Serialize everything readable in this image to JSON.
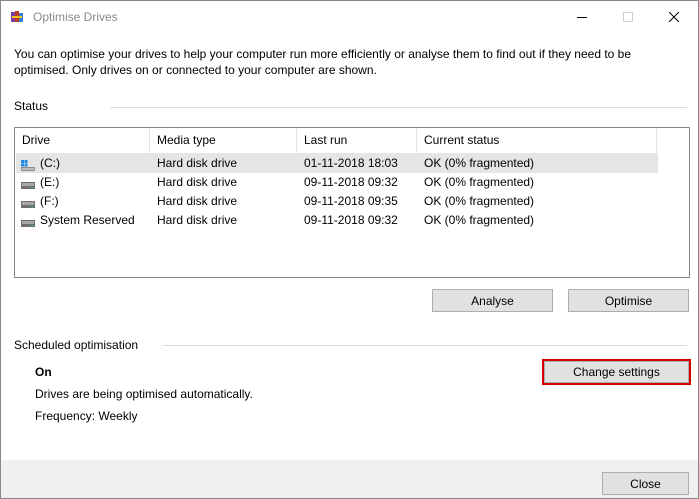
{
  "window": {
    "title": "Optimise Drives",
    "app_icon": "defrag-app-icon",
    "controls": {
      "minimize": "minimize-icon",
      "maximize": "maximize-icon",
      "close": "close-icon"
    }
  },
  "description": "You can optimise your drives to help your computer run more efficiently or analyse them to find out if they need to be optimised. Only drives on or connected to your computer are shown.",
  "status": {
    "label": "Status",
    "columns": [
      "Drive",
      "Media type",
      "Last run",
      "Current status"
    ],
    "rows": [
      {
        "icon": "system-drive-icon",
        "drive": "(C:)",
        "media": "Hard disk drive",
        "last_run": "01-11-2018 18:03",
        "status": "OK (0% fragmented)"
      },
      {
        "icon": "hard-drive-icon",
        "drive": "(E:)",
        "media": "Hard disk drive",
        "last_run": "09-11-2018 09:32",
        "status": "OK (0% fragmented)"
      },
      {
        "icon": "hard-drive-icon",
        "drive": "(F:)",
        "media": "Hard disk drive",
        "last_run": "09-11-2018 09:35",
        "status": "OK (0% fragmented)"
      },
      {
        "icon": "hard-drive-icon",
        "drive": "System Reserved",
        "media": "Hard disk drive",
        "last_run": "09-11-2018 09:32",
        "status": "OK (0% fragmented)"
      }
    ],
    "selected_row": 0,
    "analyse_label": "Analyse",
    "optimise_label": "Optimise"
  },
  "scheduled": {
    "label": "Scheduled optimisation",
    "state": "On",
    "detail": "Drives are being optimised automatically.",
    "frequency": "Frequency: Weekly",
    "change_label": "Change settings"
  },
  "footer": {
    "close_label": "Close"
  },
  "colors": {
    "focus_border": "#d40000",
    "button_face": "#e1e1e1",
    "selected_row": "#e5e5e5"
  }
}
